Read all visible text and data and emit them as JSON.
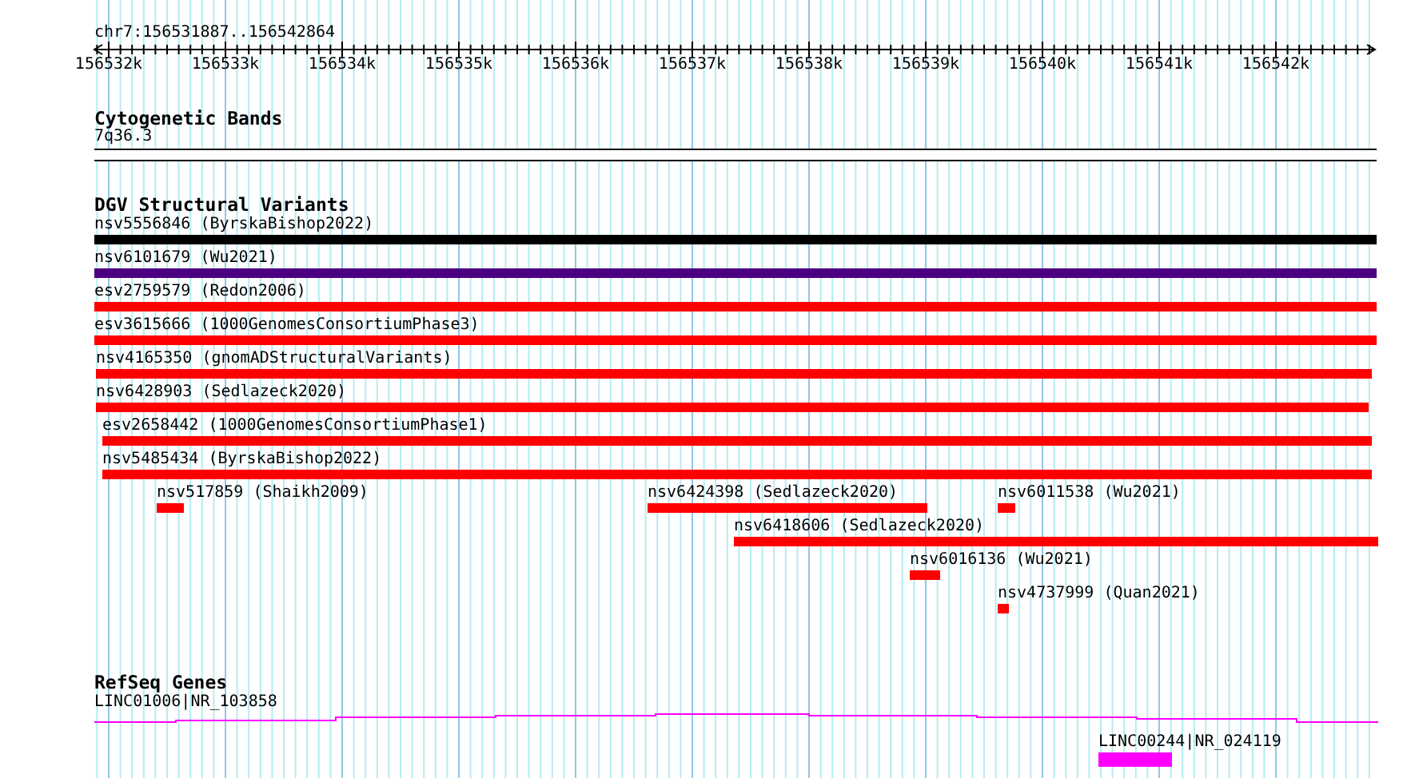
{
  "ruler": {
    "location": "chr7:156531887..156542864",
    "ticks": [
      "156532k",
      "156533k",
      "156534k",
      "156535k",
      "156536k",
      "156537k",
      "156538k",
      "156539k",
      "156540k",
      "156541k",
      "156542k"
    ]
  },
  "tracks": [
    {
      "kind": "bands",
      "title": "Cytogenetic Bands",
      "features": [
        {
          "label": "7q36.3"
        }
      ]
    },
    {
      "kind": "variants",
      "title": "DGV Structural Variants",
      "features": [
        {
          "label": "nsv5556846 (ByrskaBishop2022)",
          "color": "#000000"
        },
        {
          "label": "nsv6101679 (Wu2021)",
          "color": "#4b0082"
        },
        {
          "label": "esv2759579 (Redon2006)",
          "color": "#ff0000"
        },
        {
          "label": "esv3615666 (1000GenomesConsortiumPhase3)",
          "color": "#ff0000"
        },
        {
          "label": "nsv4165350 (gnomADStructuralVariants)",
          "color": "#ff0000"
        },
        {
          "label": "nsv6428903 (Sedlazeck2020)",
          "color": "#ff0000"
        },
        {
          "label": "esv2658442 (1000GenomesConsortiumPhase1)",
          "color": "#ff0000"
        },
        {
          "label": "nsv5485434 (ByrskaBishop2022)",
          "color": "#ff0000"
        },
        {
          "label": "nsv517859 (Shaikh2009)",
          "color": "#ff0000"
        },
        {
          "label": "nsv6424398 (Sedlazeck2020)",
          "color": "#ff0000"
        },
        {
          "label": "nsv6011538 (Wu2021)",
          "color": "#ff0000"
        },
        {
          "label": "nsv6418606 (Sedlazeck2020)",
          "color": "#ff0000"
        },
        {
          "label": "nsv6016136 (Wu2021)",
          "color": "#ff0000"
        },
        {
          "label": "nsv4737999 (Quan2021)",
          "color": "#ff0000"
        }
      ]
    },
    {
      "kind": "genes",
      "title": "RefSeq Genes",
      "features": [
        {
          "label": "LINC01006|NR_103858",
          "color": "#ff00ff"
        },
        {
          "label": "LINC00244|NR_024119",
          "color": "#ff00ff"
        }
      ]
    }
  ]
}
